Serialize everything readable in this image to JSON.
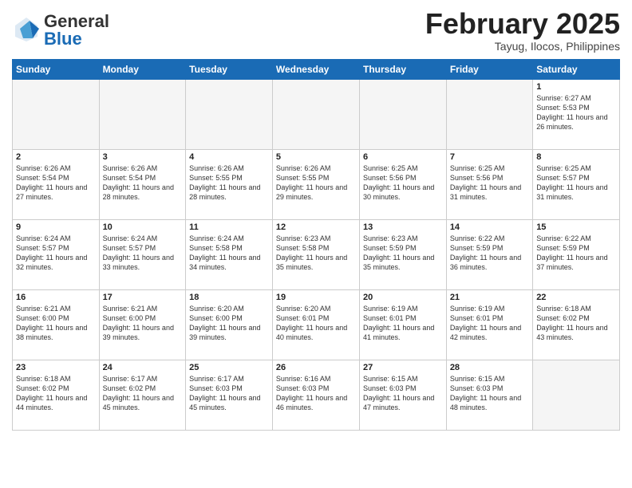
{
  "header": {
    "logo_general": "General",
    "logo_blue": "Blue",
    "month": "February 2025",
    "location": "Tayug, Ilocos, Philippines"
  },
  "weekdays": [
    "Sunday",
    "Monday",
    "Tuesday",
    "Wednesday",
    "Thursday",
    "Friday",
    "Saturday"
  ],
  "weeks": [
    [
      {
        "day": "",
        "info": ""
      },
      {
        "day": "",
        "info": ""
      },
      {
        "day": "",
        "info": ""
      },
      {
        "day": "",
        "info": ""
      },
      {
        "day": "",
        "info": ""
      },
      {
        "day": "",
        "info": ""
      },
      {
        "day": "1",
        "info": "Sunrise: 6:27 AM\nSunset: 5:53 PM\nDaylight: 11 hours and 26 minutes."
      }
    ],
    [
      {
        "day": "2",
        "info": "Sunrise: 6:26 AM\nSunset: 5:54 PM\nDaylight: 11 hours and 27 minutes."
      },
      {
        "day": "3",
        "info": "Sunrise: 6:26 AM\nSunset: 5:54 PM\nDaylight: 11 hours and 28 minutes."
      },
      {
        "day": "4",
        "info": "Sunrise: 6:26 AM\nSunset: 5:55 PM\nDaylight: 11 hours and 28 minutes."
      },
      {
        "day": "5",
        "info": "Sunrise: 6:26 AM\nSunset: 5:55 PM\nDaylight: 11 hours and 29 minutes."
      },
      {
        "day": "6",
        "info": "Sunrise: 6:25 AM\nSunset: 5:56 PM\nDaylight: 11 hours and 30 minutes."
      },
      {
        "day": "7",
        "info": "Sunrise: 6:25 AM\nSunset: 5:56 PM\nDaylight: 11 hours and 31 minutes."
      },
      {
        "day": "8",
        "info": "Sunrise: 6:25 AM\nSunset: 5:57 PM\nDaylight: 11 hours and 31 minutes."
      }
    ],
    [
      {
        "day": "9",
        "info": "Sunrise: 6:24 AM\nSunset: 5:57 PM\nDaylight: 11 hours and 32 minutes."
      },
      {
        "day": "10",
        "info": "Sunrise: 6:24 AM\nSunset: 5:57 PM\nDaylight: 11 hours and 33 minutes."
      },
      {
        "day": "11",
        "info": "Sunrise: 6:24 AM\nSunset: 5:58 PM\nDaylight: 11 hours and 34 minutes."
      },
      {
        "day": "12",
        "info": "Sunrise: 6:23 AM\nSunset: 5:58 PM\nDaylight: 11 hours and 35 minutes."
      },
      {
        "day": "13",
        "info": "Sunrise: 6:23 AM\nSunset: 5:59 PM\nDaylight: 11 hours and 35 minutes."
      },
      {
        "day": "14",
        "info": "Sunrise: 6:22 AM\nSunset: 5:59 PM\nDaylight: 11 hours and 36 minutes."
      },
      {
        "day": "15",
        "info": "Sunrise: 6:22 AM\nSunset: 5:59 PM\nDaylight: 11 hours and 37 minutes."
      }
    ],
    [
      {
        "day": "16",
        "info": "Sunrise: 6:21 AM\nSunset: 6:00 PM\nDaylight: 11 hours and 38 minutes."
      },
      {
        "day": "17",
        "info": "Sunrise: 6:21 AM\nSunset: 6:00 PM\nDaylight: 11 hours and 39 minutes."
      },
      {
        "day": "18",
        "info": "Sunrise: 6:20 AM\nSunset: 6:00 PM\nDaylight: 11 hours and 39 minutes."
      },
      {
        "day": "19",
        "info": "Sunrise: 6:20 AM\nSunset: 6:01 PM\nDaylight: 11 hours and 40 minutes."
      },
      {
        "day": "20",
        "info": "Sunrise: 6:19 AM\nSunset: 6:01 PM\nDaylight: 11 hours and 41 minutes."
      },
      {
        "day": "21",
        "info": "Sunrise: 6:19 AM\nSunset: 6:01 PM\nDaylight: 11 hours and 42 minutes."
      },
      {
        "day": "22",
        "info": "Sunrise: 6:18 AM\nSunset: 6:02 PM\nDaylight: 11 hours and 43 minutes."
      }
    ],
    [
      {
        "day": "23",
        "info": "Sunrise: 6:18 AM\nSunset: 6:02 PM\nDaylight: 11 hours and 44 minutes."
      },
      {
        "day": "24",
        "info": "Sunrise: 6:17 AM\nSunset: 6:02 PM\nDaylight: 11 hours and 45 minutes."
      },
      {
        "day": "25",
        "info": "Sunrise: 6:17 AM\nSunset: 6:03 PM\nDaylight: 11 hours and 45 minutes."
      },
      {
        "day": "26",
        "info": "Sunrise: 6:16 AM\nSunset: 6:03 PM\nDaylight: 11 hours and 46 minutes."
      },
      {
        "day": "27",
        "info": "Sunrise: 6:15 AM\nSunset: 6:03 PM\nDaylight: 11 hours and 47 minutes."
      },
      {
        "day": "28",
        "info": "Sunrise: 6:15 AM\nSunset: 6:03 PM\nDaylight: 11 hours and 48 minutes."
      },
      {
        "day": "",
        "info": ""
      }
    ]
  ]
}
